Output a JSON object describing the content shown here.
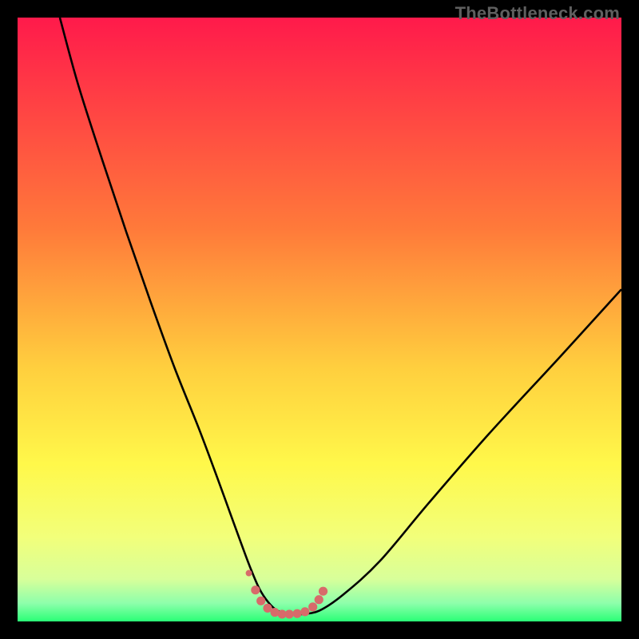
{
  "watermark": "TheBottleneck.com",
  "colors": {
    "page_bg": "#000000",
    "watermark": "#5f5f5f",
    "curve": "#000000",
    "dots": "#d86a6a",
    "grad_top": "#ff1a4b",
    "grad_mid1": "#ff8a3a",
    "grad_mid2": "#ffe94a",
    "grad_low": "#f6ff8a",
    "grad_bottom": "#2aff76"
  },
  "gradient_stops": [
    {
      "offset": 0.0,
      "color": "#ff1a4b"
    },
    {
      "offset": 0.35,
      "color": "#ff7a3a"
    },
    {
      "offset": 0.58,
      "color": "#ffcf3e"
    },
    {
      "offset": 0.74,
      "color": "#fff84a"
    },
    {
      "offset": 0.86,
      "color": "#f2ff7a"
    },
    {
      "offset": 0.93,
      "color": "#d8ff9a"
    },
    {
      "offset": 0.97,
      "color": "#8dffab"
    },
    {
      "offset": 1.0,
      "color": "#2aff76"
    }
  ],
  "chart_data": {
    "type": "line",
    "title": "",
    "xlabel": "",
    "ylabel": "",
    "xlim": [
      0,
      100
    ],
    "ylim": [
      0,
      100
    ],
    "grid": false,
    "legend": false,
    "series": [
      {
        "name": "bottleneck-curve",
        "x": [
          7,
          10,
          14,
          18,
          22,
          26,
          30,
          33,
          35,
          37,
          38.5,
          40,
          41.5,
          43,
          45,
          47,
          50,
          54,
          60,
          68,
          78,
          90,
          100
        ],
        "y": [
          100,
          89,
          76.5,
          64.5,
          53,
          42,
          32,
          24,
          18.5,
          13,
          9,
          5.5,
          3.2,
          1.8,
          1.2,
          1.2,
          1.8,
          4.5,
          10,
          19.5,
          31,
          44,
          55
        ]
      }
    ],
    "markers": {
      "name": "trough-dots",
      "x": [
        38.3,
        39.4,
        40.3,
        41.4,
        42.6,
        43.8,
        45.0,
        46.3,
        47.6,
        48.9,
        49.9,
        50.6
      ],
      "y": [
        8.0,
        5.2,
        3.4,
        2.2,
        1.5,
        1.2,
        1.2,
        1.3,
        1.6,
        2.4,
        3.6,
        5.0
      ],
      "r_first": 4.0,
      "r_rest": 5.6
    }
  }
}
